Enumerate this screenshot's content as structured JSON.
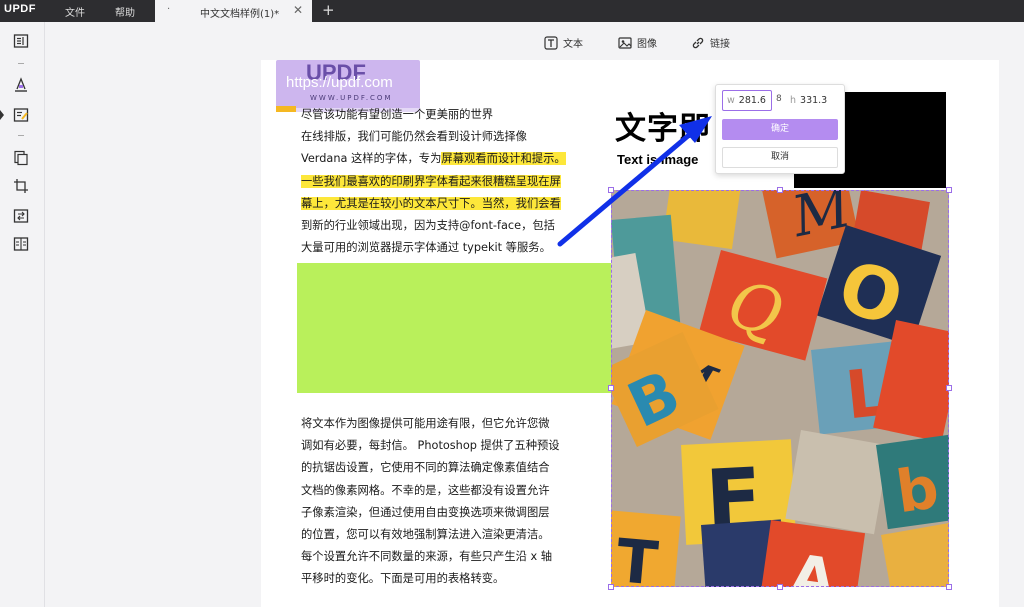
{
  "app": {
    "logo": "UPDF",
    "menu": [
      "文件",
      "帮助"
    ],
    "tab_title": "中文文档样例(1)*",
    "tab_dot": "·",
    "tab_close": "✕",
    "new_tab": "+"
  },
  "toolbar": {
    "text_label": "文本",
    "image_label": "图像",
    "link_label": "链接"
  },
  "watermark": {
    "brand": "UPDF",
    "url": "https://updf.com",
    "sub": "WWW.UPDF.COM"
  },
  "paragraph1": {
    "line1": "尽管该功能有望创造一个更美丽的世界",
    "line2": "在线排版，我们可能仍然会看到设计师选择像",
    "line3_normal": "Verdana 这样的字体，专为",
    "line3_hl": "屏幕观看而设计和提示。",
    "line4_hl": "一些我们最喜欢的印刷界字体看起来很糟糕呈现在屏",
    "line5_hl": "幕上，尤其是在较小的文本尺寸下。当然，我们会看",
    "line6": "到新的行业领域出现，因为支持@font-face，包括",
    "line7": "大量可用的浏览器提示字体通过 typekit 等服务。"
  },
  "paragraph2": {
    "lines": [
      "将文本作为图像提供可能用途有限，但它允许您微",
      "调如有必要，每封信。 Photoshop 提供了五种预设",
      "的抗锯齿设置，它使用不同的算法确定像素值结合",
      "文档的像素网格。不幸的是，这些都没有设置允许",
      "子像素渲染，但通过使用自由变换选项来微调图层",
      "的位置，您可以有效地强制算法进入渲染更清洁。",
      "每个设置允许不同数量的来源，有些只产生沿 x 轴",
      "平移时的变化。下面是可用的表格转变。"
    ]
  },
  "heading": {
    "title": "文字即",
    "subtitle": "Text is Image"
  },
  "size_popup": {
    "w_label": "w",
    "w_value": "281.6",
    "link_icon": "8",
    "h_label": "h",
    "h_value": "331.3",
    "confirm_label": "确定",
    "cancel_label": "取消"
  },
  "colors": {
    "accent": "#b48cf0",
    "highlight": "#fde73a",
    "green_block": "#b9f05b",
    "arrow": "#1030e8"
  }
}
